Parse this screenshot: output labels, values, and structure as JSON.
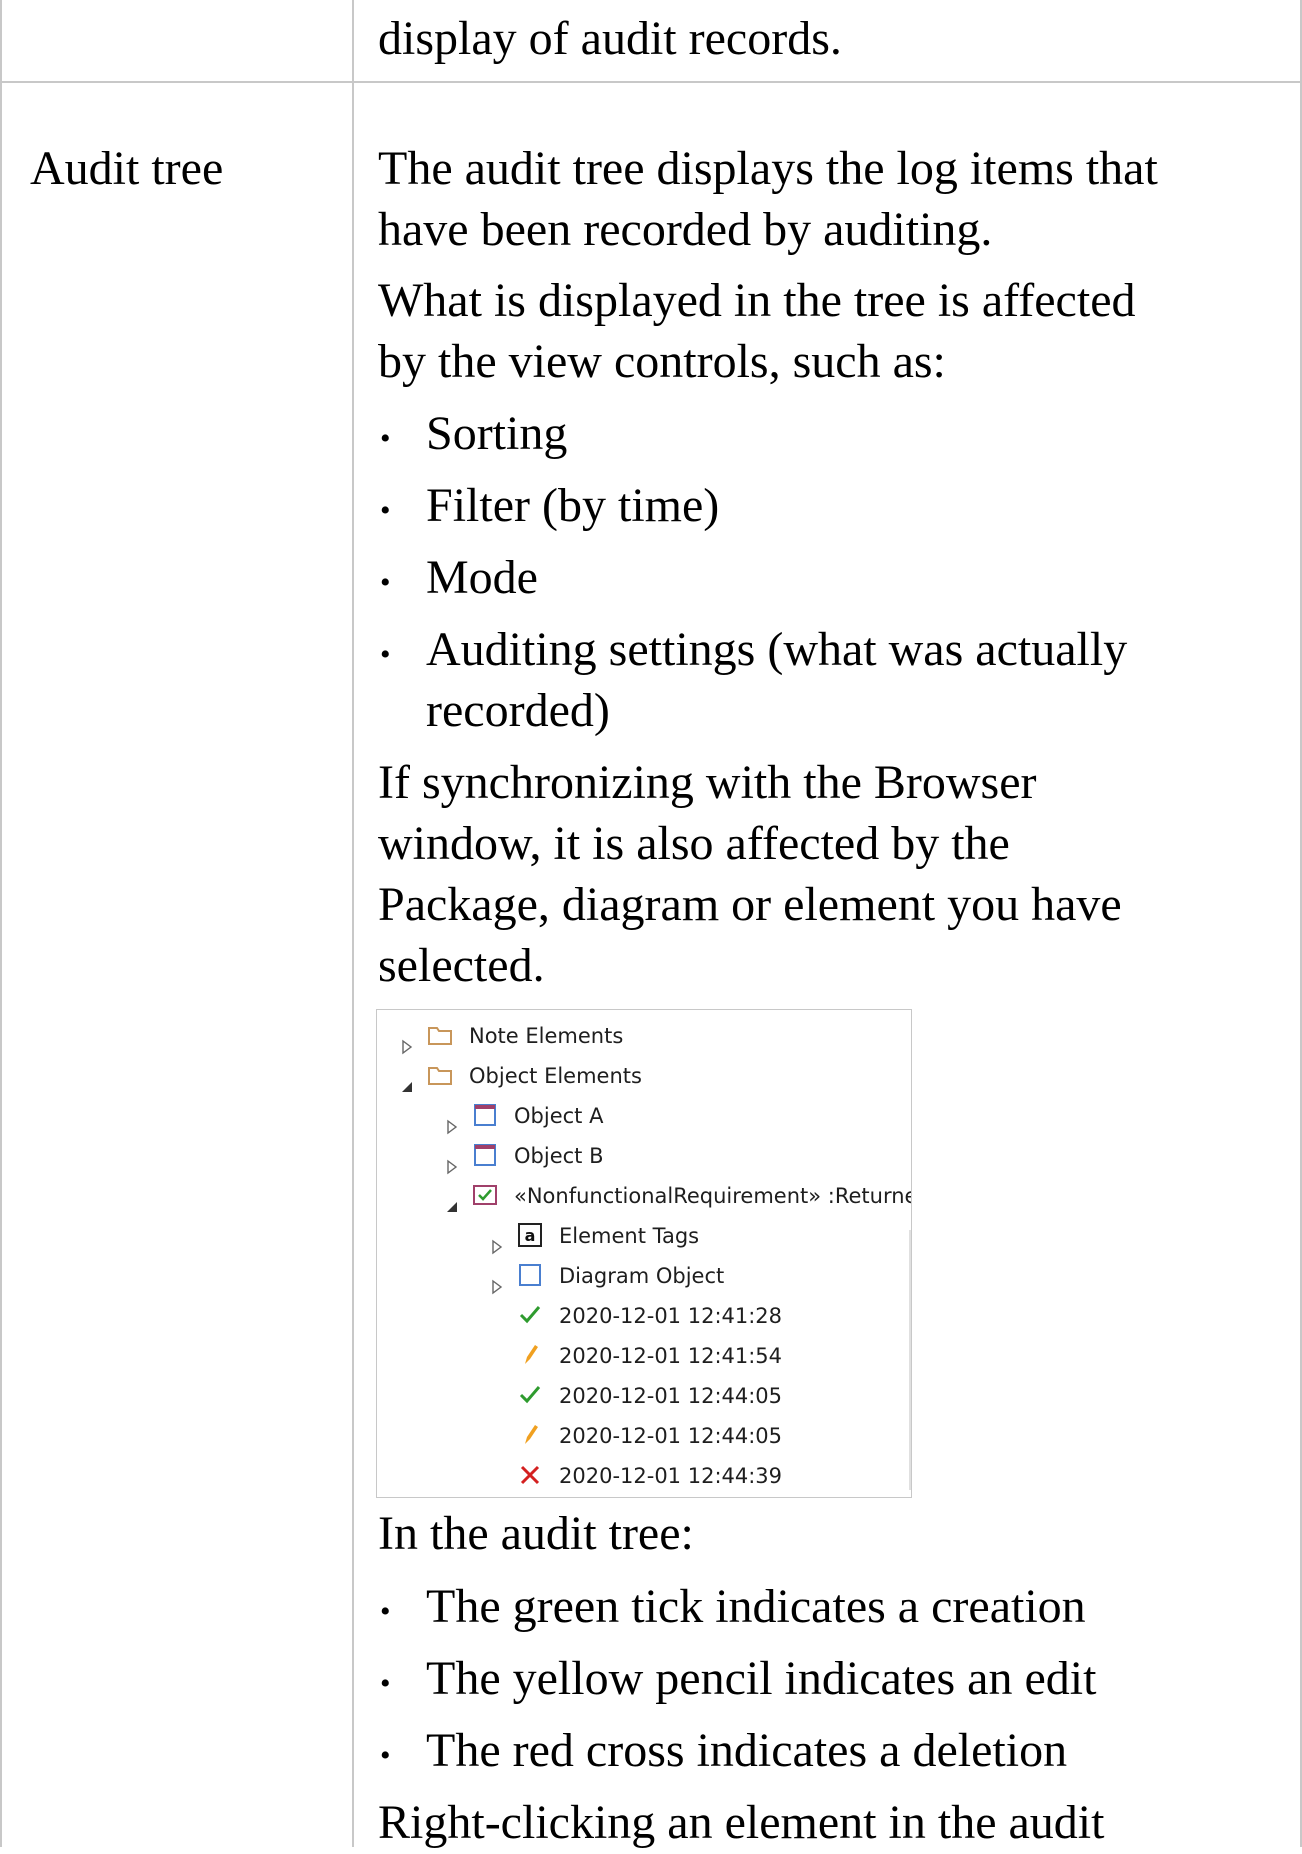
{
  "table": {
    "top_row": {
      "description_tail": "display of audit records."
    },
    "row": {
      "label": "Audit tree",
      "paragraph1": [
        "The audit tree displays the log items that",
        "have been recorded by auditing."
      ],
      "paragraph2": [
        "What is displayed in the tree is affected",
        "by the view controls, such as:"
      ],
      "view_controls": [
        "Sorting",
        "Filter (by time)",
        "Mode",
        "Auditing settings (what was actually",
        "recorded)"
      ],
      "paragraph3": [
        "If synchronizing with the Browser",
        "window, it is also affected by the",
        "Package, diagram or element you have",
        "selected."
      ],
      "legend_intro": "In the audit tree:",
      "legend": [
        "The green tick indicates a creation",
        "The yellow pencil indicates an edit",
        "The red cross indicates a deletion"
      ],
      "paragraph4": "Right-clicking an element in the audit"
    }
  },
  "tree": {
    "colors": {
      "folder": "#c8965a",
      "tick": "#2e9b2e",
      "pencil": "#f0a020",
      "cross": "#d42020",
      "element": "#4a7fd0",
      "element_top": "#a0406a"
    },
    "items": [
      {
        "expander": "collapsed",
        "icon": "folder-icon",
        "label": "Note Elements"
      },
      {
        "expander": "expanded",
        "icon": "folder-icon",
        "label": "Object Elements"
      },
      {
        "expander": "collapsed",
        "icon": "object-icon",
        "label": "Object A"
      },
      {
        "expander": "collapsed",
        "icon": "object-icon",
        "label": "Object B"
      },
      {
        "expander": "expanded",
        "icon": "requirement-icon",
        "label": "«NonfunctionalRequirement» :Returned"
      },
      {
        "expander": "collapsed",
        "icon": "tags-icon",
        "label": "Element Tags",
        "icon_text": "a"
      },
      {
        "expander": "collapsed",
        "icon": "diagram-object-icon",
        "label": "Diagram Object"
      },
      {
        "expander": "none",
        "icon": "tick-icon",
        "label": "2020-12-01 12:41:28"
      },
      {
        "expander": "none",
        "icon": "pencil-icon",
        "label": "2020-12-01 12:41:54"
      },
      {
        "expander": "none",
        "icon": "tick-icon",
        "label": "2020-12-01 12:44:05"
      },
      {
        "expander": "none",
        "icon": "pencil-icon",
        "label": "2020-12-01 12:44:05"
      },
      {
        "expander": "none",
        "icon": "cross-icon",
        "label": "2020-12-01 12:44:39"
      }
    ]
  }
}
